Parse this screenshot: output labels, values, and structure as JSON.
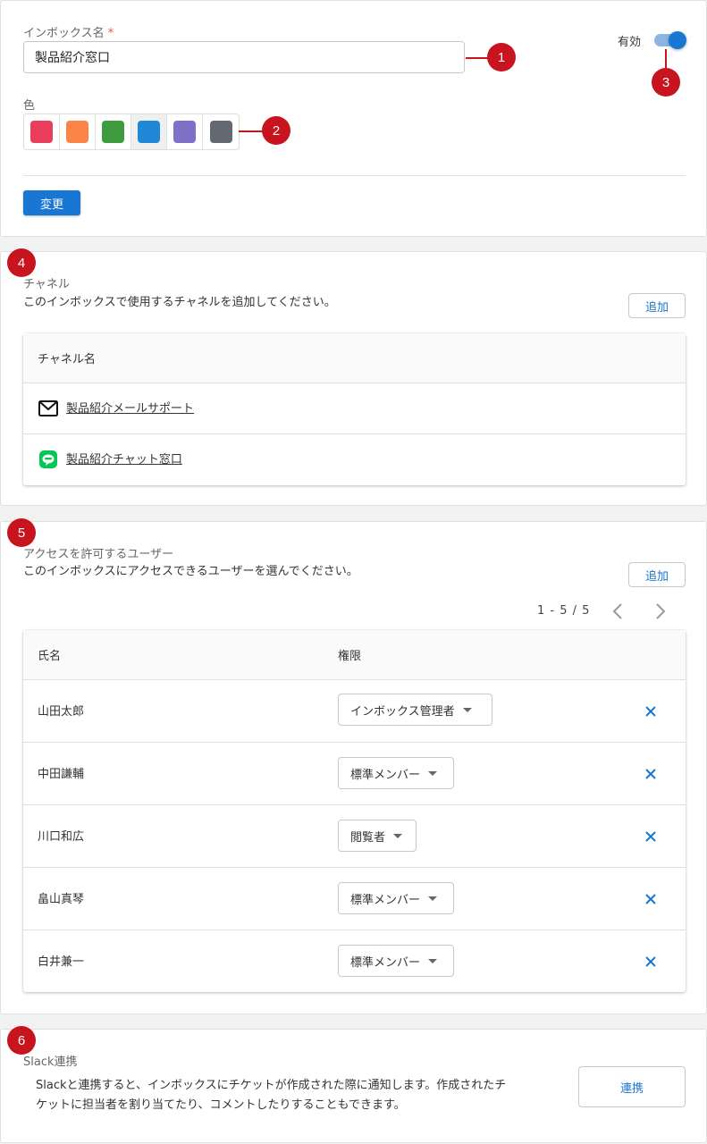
{
  "inbox_settings": {
    "name_label": "インボックス名",
    "required_mark": "*",
    "name_value": "製品紹介窓口",
    "color_label": "色",
    "colors": [
      "#e83d5b",
      "#fd8447",
      "#3d9b3d",
      "#2188d8",
      "#8071c8",
      "#636973"
    ],
    "selected_color_index": 3,
    "enabled_label": "有効",
    "enabled": true,
    "save_label": "変更",
    "markers": [
      "1",
      "2",
      "3"
    ]
  },
  "channels": {
    "marker": "4",
    "title": "チャネル",
    "description": "このインボックスで使用するチャネルを追加してください。",
    "add_label": "追加",
    "column_header": "チャネル名",
    "items": [
      {
        "name": "製品紹介メールサポート",
        "icon": "mail-icon"
      },
      {
        "name": "製品紹介チャット窓口",
        "icon": "line-icon"
      }
    ]
  },
  "access": {
    "marker": "5",
    "title": "アクセスを許可するユーザー",
    "description": "このインボックスにアクセスできるユーザーを選んでください。",
    "add_label": "追加",
    "pagination": "1 - 5 / 5",
    "column_name": "氏名",
    "column_role": "権限",
    "users": [
      {
        "name": "山田太郎",
        "role": "インボックス管理者"
      },
      {
        "name": "中田謙輔",
        "role": "標準メンバー"
      },
      {
        "name": "川口和広",
        "role": "閲覧者"
      },
      {
        "name": "畠山真琴",
        "role": "標準メンバー"
      },
      {
        "name": "白井兼一",
        "role": "標準メンバー"
      }
    ]
  },
  "slack": {
    "marker": "6",
    "title": "Slack連携",
    "description_line1": "Slackと連携すると、インボックスにチケットが作成された際に通知します。作成されたチ",
    "description_line2": "ケットに担当者を割り当てたり、コメントしたりすることもできます。",
    "connect_label": "連携"
  },
  "colors": {
    "accent": "#1976d2",
    "marker": "#c8141e"
  }
}
